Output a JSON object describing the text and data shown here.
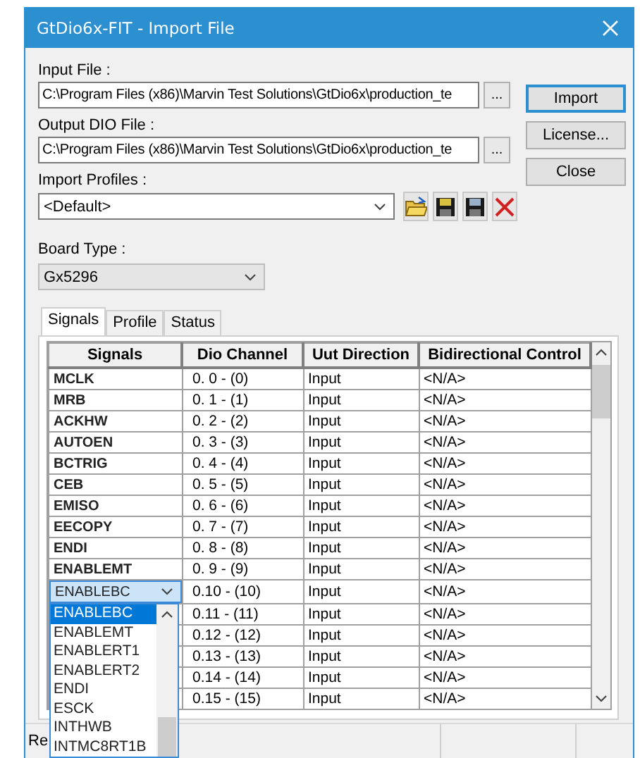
{
  "window": {
    "title": "GtDio6x-FIT - Import File"
  },
  "input_file": {
    "label": "Input File :",
    "value": "C:\\Program Files (x86)\\Marvin Test Solutions\\GtDio6x\\production_te",
    "browse": "..."
  },
  "output_file": {
    "label": "Output DIO File :",
    "value": "C:\\Program Files (x86)\\Marvin Test Solutions\\GtDio6x\\production_te",
    "browse": "..."
  },
  "buttons": [
    {
      "label": "Import",
      "default": true
    },
    {
      "label": "License...",
      "default": false
    },
    {
      "label": "Close",
      "default": false
    }
  ],
  "import_profiles": {
    "label": "Import Profiles :",
    "value": "<Default>"
  },
  "profile_tools": [
    {
      "kind": "open"
    },
    {
      "kind": "save"
    },
    {
      "kind": "save_as"
    },
    {
      "kind": "delete"
    }
  ],
  "board_type": {
    "label": "Board Type :",
    "value": "Gx5296",
    "disabled": true
  },
  "tabs": [
    {
      "label": "Signals",
      "selected": true
    },
    {
      "label": "Profile",
      "selected": false
    },
    {
      "label": "Status",
      "selected": false
    }
  ],
  "table": {
    "columns": [
      "Signals",
      "Dio Channel",
      "Uut Direction",
      "Bidirectional Control"
    ],
    "rows": [
      {
        "signal": "MCLK",
        "channel": "0. 0 - (0)",
        "direction": "Input",
        "control": "<N/A>"
      },
      {
        "signal": "MRB",
        "channel": "0. 1 - (1)",
        "direction": "Input",
        "control": "<N/A>"
      },
      {
        "signal": "ACKHW",
        "channel": "0. 2 - (2)",
        "direction": "Input",
        "control": "<N/A>"
      },
      {
        "signal": "AUTOEN",
        "channel": "0. 3 - (3)",
        "direction": "Input",
        "control": "<N/A>"
      },
      {
        "signal": "BCTRIG",
        "channel": "0. 4 - (4)",
        "direction": "Input",
        "control": "<N/A>"
      },
      {
        "signal": "CEB",
        "channel": "0. 5 - (5)",
        "direction": "Input",
        "control": "<N/A>"
      },
      {
        "signal": "EMISO",
        "channel": "0. 6 - (6)",
        "direction": "Input",
        "control": "<N/A>"
      },
      {
        "signal": "EECOPY",
        "channel": "0. 7 - (7)",
        "direction": "Input",
        "control": "<N/A>"
      },
      {
        "signal": "ENDI",
        "channel": "0. 8 - (8)",
        "direction": "Input",
        "control": "<N/A>"
      },
      {
        "signal": "ENABLEMT",
        "channel": "0. 9 - (9)",
        "direction": "Input",
        "control": "<N/A>"
      },
      {
        "signal": "ENABLEBC",
        "editing": true,
        "channel": "0.10 - (10)",
        "direction": "Input",
        "control": "<N/A>",
        "dropdown": [
          {
            "label": "ENABLEBC",
            "selected": true
          },
          {
            "label": "ENABLEMT",
            "selected": false
          },
          {
            "label": "ENABLERT1",
            "selected": false
          },
          {
            "label": "ENABLERT2",
            "selected": false
          },
          {
            "label": "ENDI",
            "selected": false
          },
          {
            "label": "ESCK",
            "selected": false
          },
          {
            "label": "INTHWB",
            "selected": false
          },
          {
            "label": "INTMC8RT1B",
            "selected": false
          }
        ]
      },
      {
        "channel": "0.11 - (11)",
        "direction": "Input",
        "control": "<N/A>"
      },
      {
        "channel": "0.12 - (12)",
        "direction": "Input",
        "control": "<N/A>"
      },
      {
        "channel": "0.13 - (13)",
        "direction": "Input",
        "control": "<N/A>"
      },
      {
        "channel": "0.14 - (14)",
        "direction": "Input",
        "control": "<N/A>"
      },
      {
        "channel": "0.15 - (15)",
        "direction": "Input",
        "control": "<N/A>"
      }
    ]
  },
  "status_bar": {
    "text": "Re"
  }
}
